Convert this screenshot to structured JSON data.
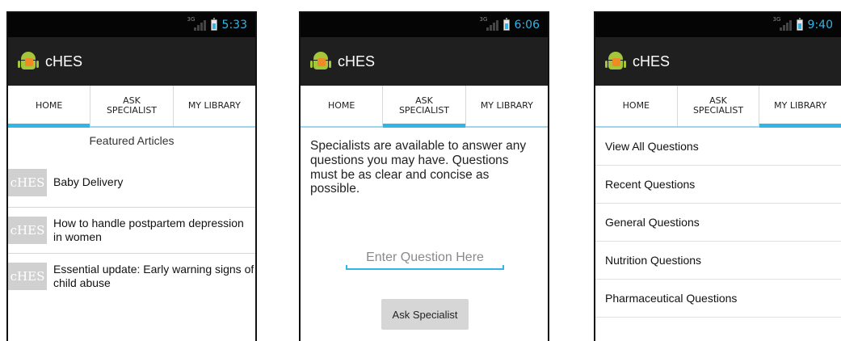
{
  "app": {
    "title": "cHES"
  },
  "tabs": [
    "HOME",
    "ASK\nSPECIALIST",
    "MY LIBRARY"
  ],
  "screens": [
    {
      "time": "5:33",
      "featured_heading": "Featured Articles",
      "articles": [
        {
          "thumb": "cHES",
          "title": "Baby Delivery"
        },
        {
          "thumb": "cHES",
          "title": "How to handle postpartem depression in women"
        },
        {
          "thumb": "cHES",
          "title": "Essential update: Early warning signs of child abuse"
        }
      ]
    },
    {
      "time": "6:06",
      "intro": "Specialists are available to answer any questions you may have. Questions must be as clear and concise as possible.",
      "question_placeholder": "Enter Question Here",
      "ask_button": "Ask Specialist"
    },
    {
      "time": "9:40",
      "library_items": [
        "View All Questions",
        "Recent Questions",
        "General Questions",
        "Nutrition Questions",
        "Pharmaceutical Questions"
      ]
    }
  ],
  "status": {
    "network_tag": "3G"
  },
  "colors": {
    "accent": "#33b5e5",
    "actionbar": "#1f1f1f",
    "statusbar": "#050505"
  }
}
